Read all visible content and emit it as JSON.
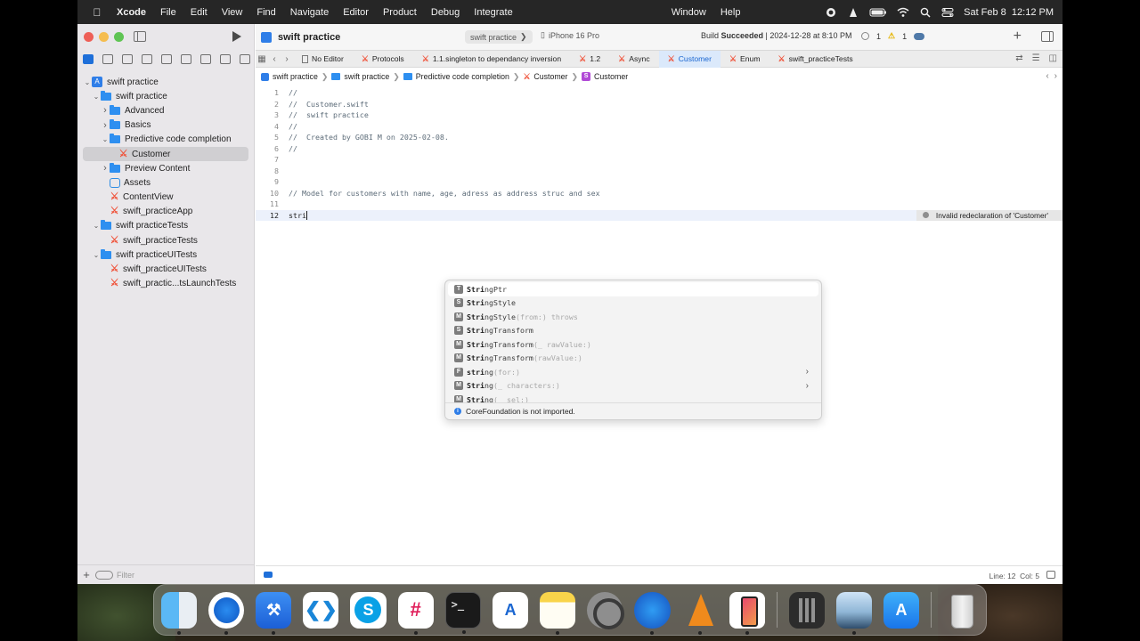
{
  "menubar": {
    "app_name": "Xcode",
    "menus": [
      "File",
      "Edit",
      "View",
      "Find",
      "Navigate",
      "Editor",
      "Product",
      "Debug",
      "Integrate",
      "Window",
      "Help"
    ],
    "datetime": "Sat Feb 8  12:12 PM"
  },
  "toolbar": {
    "project_title": "swift practice",
    "scheme": "swift practice",
    "device": "iPhone 16 Pro",
    "build_status_prefix": "Build ",
    "build_status_result": "Succeeded",
    "build_status_time": " | 2024-12-28 at 8:10 PM",
    "error_count": "1",
    "warning_count": "1",
    "add_label": "+"
  },
  "tabs": [
    {
      "label": "No Editor",
      "type": "doc",
      "active": false
    },
    {
      "label": "Protocols",
      "type": "swift",
      "active": false
    },
    {
      "label": "1.1.singleton to dependancy inversion",
      "type": "swift",
      "active": false
    },
    {
      "label": "1.2",
      "type": "swift",
      "active": false
    },
    {
      "label": "Async",
      "type": "swift",
      "active": false
    },
    {
      "label": "Customer",
      "type": "swift",
      "active": true
    },
    {
      "label": "Enum",
      "type": "swift",
      "active": false
    },
    {
      "label": "swift_practiceTests",
      "type": "swift",
      "active": false
    }
  ],
  "jumpbar": {
    "items": [
      "swift practice",
      "swift practice",
      "Predictive code completion",
      "Customer",
      "Customer"
    ]
  },
  "navigator": {
    "items": [
      {
        "label": "swift practice",
        "level": 0,
        "type": "project",
        "expanded": true
      },
      {
        "label": "swift practice",
        "level": 1,
        "type": "folder",
        "expanded": true
      },
      {
        "label": "Advanced",
        "level": 2,
        "type": "folder",
        "expanded": false
      },
      {
        "label": "Basics",
        "level": 2,
        "type": "folder",
        "expanded": false
      },
      {
        "label": "Predictive code completion",
        "level": 2,
        "type": "folder",
        "expanded": true
      },
      {
        "label": "Customer",
        "level": 3,
        "type": "swift",
        "selected": true
      },
      {
        "label": "Preview Content",
        "level": 2,
        "type": "folder",
        "expanded": false
      },
      {
        "label": "Assets",
        "level": 2,
        "type": "assets"
      },
      {
        "label": "ContentView",
        "level": 2,
        "type": "swift"
      },
      {
        "label": "swift_practiceApp",
        "level": 2,
        "type": "swift"
      },
      {
        "label": "swift practiceTests",
        "level": 1,
        "type": "folder",
        "expanded": true
      },
      {
        "label": "swift_practiceTests",
        "level": 2,
        "type": "swift"
      },
      {
        "label": "swift practiceUITests",
        "level": 1,
        "type": "folder",
        "expanded": true
      },
      {
        "label": "swift_practiceUITests",
        "level": 2,
        "type": "swift"
      },
      {
        "label": "swift_practic...tsLaunchTests",
        "level": 2,
        "type": "swift"
      }
    ],
    "filter_placeholder": "Filter"
  },
  "editor": {
    "lines": [
      {
        "num": "1",
        "text": "//"
      },
      {
        "num": "2",
        "text": "//  Customer.swift"
      },
      {
        "num": "3",
        "text": "//  swift practice"
      },
      {
        "num": "4",
        "text": "//"
      },
      {
        "num": "5",
        "text": "//  Created by GOBI M on 2025-02-08."
      },
      {
        "num": "6",
        "text": "//"
      },
      {
        "num": "7",
        "text": ""
      },
      {
        "num": "8",
        "text": ""
      },
      {
        "num": "9",
        "text": ""
      },
      {
        "num": "10",
        "text": "// Model for customers with name, age, adress as address struc and sex"
      },
      {
        "num": "11",
        "text": ""
      },
      {
        "num": "12",
        "text": "stri"
      }
    ],
    "current_line": "12",
    "diagnostic": "Invalid redeclaration of 'Customer'"
  },
  "completion": {
    "suggestions": [
      {
        "kind": "T",
        "match": "Stri",
        "rest": "ngPtr",
        "params": "",
        "has_arrow": false
      },
      {
        "kind": "S",
        "match": "Stri",
        "rest": "ngStyle",
        "params": "",
        "has_arrow": false
      },
      {
        "kind": "M",
        "match": "Stri",
        "rest": "ngStyle",
        "params": "(from:) throws",
        "has_arrow": false
      },
      {
        "kind": "S",
        "match": "Stri",
        "rest": "ngTransform",
        "params": "",
        "has_arrow": false
      },
      {
        "kind": "M",
        "match": "Stri",
        "rest": "ngTransform",
        "params": "(_ rawValue:)",
        "has_arrow": false
      },
      {
        "kind": "M",
        "match": "Stri",
        "rest": "ngTransform",
        "params": "(rawValue:)",
        "has_arrow": false
      },
      {
        "kind": "F",
        "match": "stri",
        "rest": "ng",
        "params": "(for:)",
        "has_arrow": true
      },
      {
        "kind": "M",
        "match": "Stri",
        "rest": "ng",
        "params": "(_ characters:)",
        "has_arrow": true
      },
      {
        "kind": "M",
        "match": "Stri",
        "rest": "ng",
        "params": "(_ sel:)",
        "has_arrow": false
      }
    ],
    "footer": "CoreFoundation is not imported."
  },
  "statusbar": {
    "position": "Line: 12  Col: 5"
  },
  "dock": {
    "apps": [
      "finder-icon",
      "safari-icon",
      "xcode-icon",
      "vscode-icon",
      "skype-icon",
      "slack-icon",
      "terminal-icon",
      "instruments-icon",
      "notes-icon",
      "system-settings-icon",
      "quicktime-icon",
      "vlc-icon",
      "simulator-icon",
      "calculator-icon",
      "preview-icon",
      "app-store-icon",
      "trash-icon"
    ]
  }
}
